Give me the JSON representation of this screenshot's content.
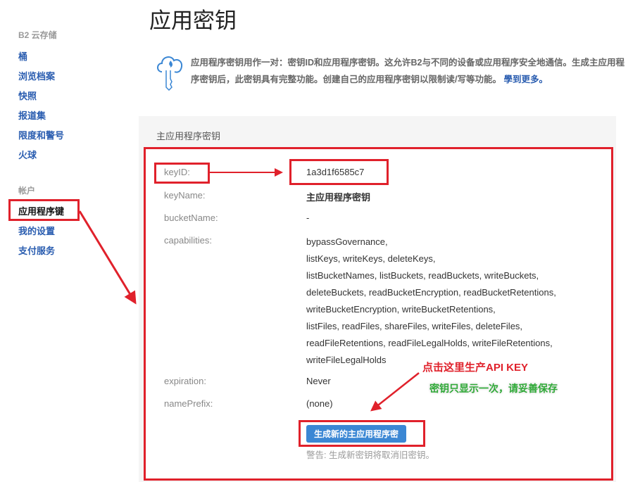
{
  "sidebar": {
    "section1": "B2 云存储",
    "items1": [
      "桶",
      "浏览档案",
      "快照",
      "报道集",
      "限度和警号",
      "火球"
    ],
    "section2": "帐户",
    "active": "应用程序键",
    "items2": [
      "我的设置",
      "支付服务"
    ]
  },
  "page": {
    "title": "应用密钥",
    "info": "应用程序密钥用作一对：密钥ID和应用程序密钥。这允许B2与不同的设备或应用程序安全地通信。生成主应用程序密钥后，此密钥具有完整功能。创建自己的应用程序密钥以限制读/写等功能。",
    "learn_more": "學到更多。"
  },
  "master_key": {
    "heading": "主应用程序密钥",
    "labels": {
      "keyID": "keyID:",
      "keyName": "keyName:",
      "bucketName": "bucketName:",
      "capabilities": "capabilities:",
      "expiration": "expiration:",
      "namePrefix": "namePrefix:"
    },
    "values": {
      "keyID": "1a3d1f6585c7",
      "keyName": "主应用程序密钥",
      "bucketName": "-",
      "expiration": "Never",
      "namePrefix": "(none)"
    },
    "capabilities": [
      "bypassGovernance,",
      "listKeys, writeKeys, deleteKeys,",
      "listBucketNames, listBuckets, readBuckets, writeBuckets,",
      "deleteBuckets, readBucketEncryption, readBucketRetentions,",
      "writeBucketEncryption, writeBucketRetentions,",
      "listFiles, readFiles, shareFiles, writeFiles, deleteFiles,",
      "readFileRetentions, readFileLegalHolds, writeFileRetentions,",
      "writeFileLegalHolds"
    ],
    "generate_button": "生成新的主应用程序密钥",
    "warning": "警告: 生成新密钥将取消旧密钥。"
  },
  "annotations": {
    "click_here": "点击这里生产API KEY",
    "show_once": "密钥只显示一次，请妥善保存"
  },
  "colors": {
    "accent": "#3b87d4",
    "annotation_red": "#e0212b",
    "annotation_green": "#2ea836"
  }
}
